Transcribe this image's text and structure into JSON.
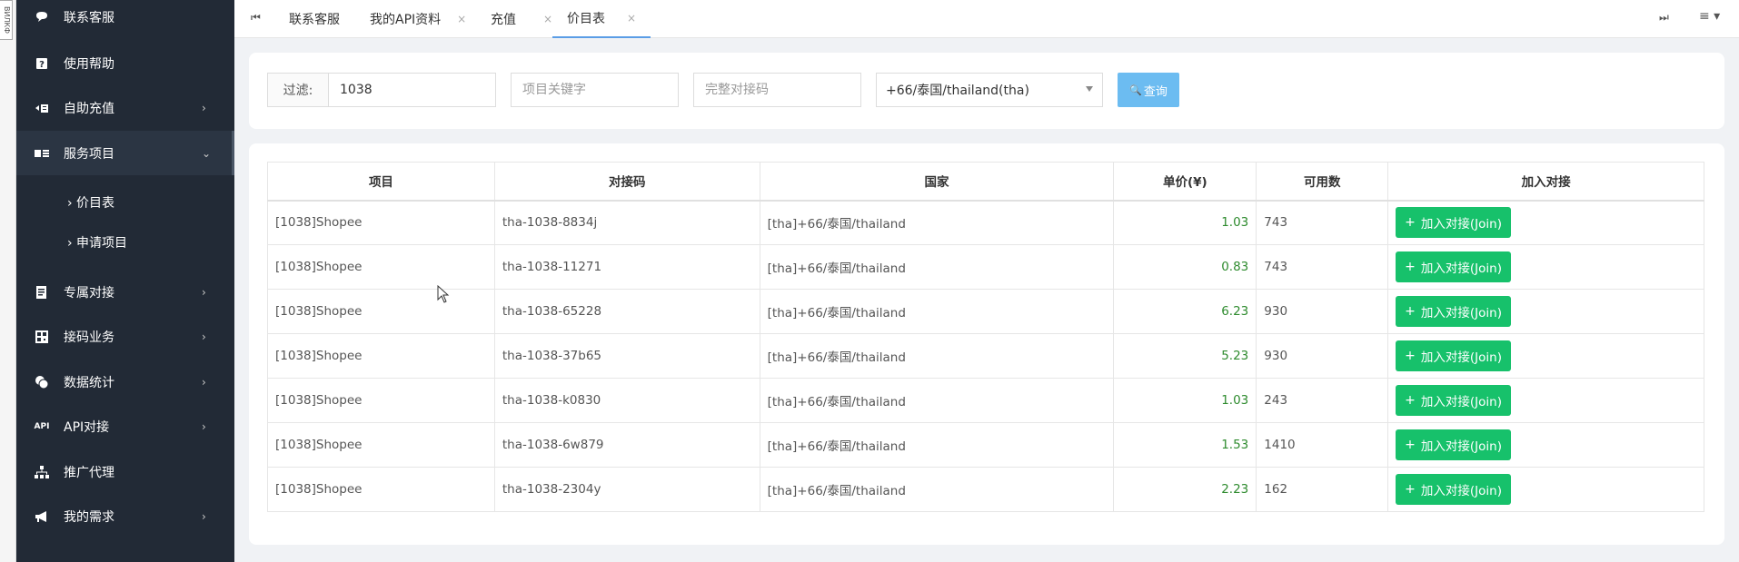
{
  "left_tab": {
    "label": "ВИЛКФ"
  },
  "sidebar": {
    "items": [
      {
        "label": "联系客服",
        "icon": "chat-icon",
        "arrow": false
      },
      {
        "label": "使用帮助",
        "icon": "help-icon",
        "arrow": false
      },
      {
        "label": "自助充值",
        "icon": "recharge-icon",
        "arrow": true
      },
      {
        "label": "服务项目",
        "icon": "service-icon",
        "arrow": true,
        "active": true
      },
      {
        "label": "专属对接",
        "icon": "document-icon",
        "arrow": true
      },
      {
        "label": "接码业务",
        "icon": "qrcode-icon",
        "arrow": true
      },
      {
        "label": "数据统计",
        "icon": "coins-icon",
        "arrow": true
      },
      {
        "label": "API对接",
        "icon": "api-icon",
        "arrow": true
      },
      {
        "label": "推广代理",
        "icon": "sitemap-icon",
        "arrow": false
      },
      {
        "label": "我的需求",
        "icon": "megaphone-icon",
        "arrow": true
      }
    ],
    "subitems": [
      {
        "label": "› 价目表"
      },
      {
        "label": "› 申请项目"
      }
    ]
  },
  "tabs": [
    {
      "label": "联系客服",
      "closable": false
    },
    {
      "label": "我的API资料",
      "closable": true
    },
    {
      "label": "充值",
      "closable": true
    },
    {
      "label": "价目表",
      "closable": true,
      "active": true
    }
  ],
  "tab_close_glyph": "×",
  "filter": {
    "label": "过滤:",
    "value": "1038",
    "keyword_placeholder": "项目关键字",
    "code_placeholder": "完整对接码",
    "country_selected": "+66/泰国/thailand(tha)",
    "query_label": "查询"
  },
  "table": {
    "headers": [
      "项目",
      "对接码",
      "国家",
      "单价(¥)",
      "可用数",
      "加入对接"
    ],
    "join_label": "加入对接(Join)",
    "rows": [
      {
        "project": "[1038]Shopee",
        "code": "tha-1038-8834j",
        "country": "[tha]+66/泰国/thailand",
        "price": "1.03",
        "available": "743"
      },
      {
        "project": "[1038]Shopee",
        "code": "tha-1038-11271",
        "country": "[tha]+66/泰国/thailand",
        "price": "0.83",
        "available": "743"
      },
      {
        "project": "[1038]Shopee",
        "code": "tha-1038-65228",
        "country": "[tha]+66/泰国/thailand",
        "price": "6.23",
        "available": "930"
      },
      {
        "project": "[1038]Shopee",
        "code": "tha-1038-37b65",
        "country": "[tha]+66/泰国/thailand",
        "price": "5.23",
        "available": "930"
      },
      {
        "project": "[1038]Shopee",
        "code": "tha-1038-k0830",
        "country": "[tha]+66/泰国/thailand",
        "price": "1.03",
        "available": "243"
      },
      {
        "project": "[1038]Shopee",
        "code": "tha-1038-6w879",
        "country": "[tha]+66/泰国/thailand",
        "price": "1.53",
        "available": "1410"
      },
      {
        "project": "[1038]Shopee",
        "code": "tha-1038-2304y",
        "country": "[tha]+66/泰国/thailand",
        "price": "2.23",
        "available": "162"
      }
    ]
  },
  "colors": {
    "sidebar_bg": "#222a36",
    "accent_blue": "#6cbcf1",
    "join_green": "#17c16b",
    "price_green": "#2e8b2e"
  }
}
